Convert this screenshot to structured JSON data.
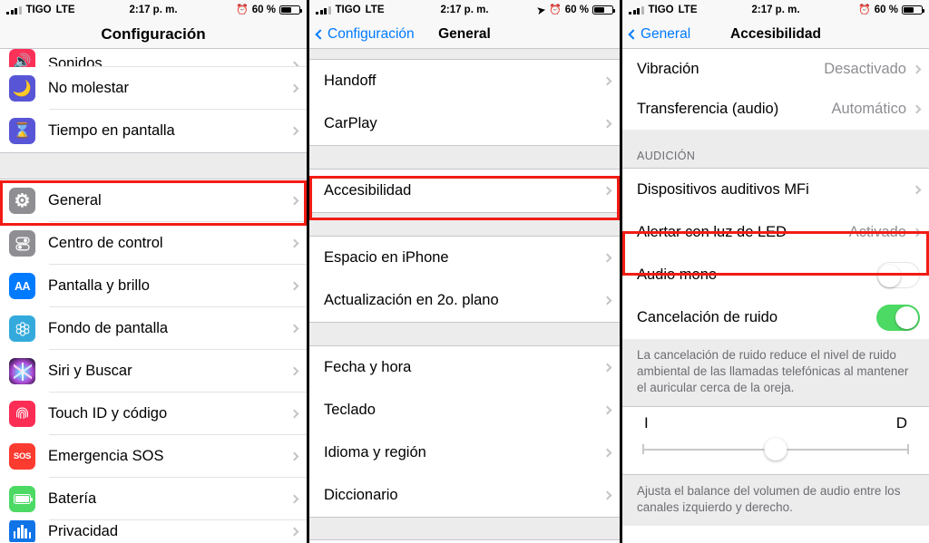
{
  "statusbar": {
    "carrier": "TIGO",
    "network": "LTE",
    "time": "2:17 p. m.",
    "battery_pct": "60 %",
    "alarm_icon": "alarm-clock-icon",
    "location_icon": "location-arrow-icon",
    "signal_icon": "cellular-bars-icon",
    "battery_icon": "battery-icon"
  },
  "panel1": {
    "nav": {
      "title": "Configuración"
    },
    "rows_top": [
      {
        "label": "Sonidos",
        "icon": "sound-icon",
        "icon_color": "#fc3158",
        "partial": true
      },
      {
        "label": "No molestar",
        "icon": "moon-icon",
        "icon_color": "#5856d6"
      },
      {
        "label": "Tiempo en pantalla",
        "icon": "hourglass-icon",
        "icon_color": "#5856d6"
      }
    ],
    "rows_main": [
      {
        "label": "General",
        "icon": "gear-icon",
        "icon_color": "#8e8e93",
        "highlighted": true
      },
      {
        "label": "Centro de control",
        "icon": "control-center-icon",
        "icon_color": "#8e8e93"
      },
      {
        "label": "Pantalla y brillo",
        "icon": "display-brightness-icon",
        "icon_color": "#007aff"
      },
      {
        "label": "Fondo de pantalla",
        "icon": "wallpaper-icon",
        "icon_color": "#34aadc"
      },
      {
        "label": "Siri y Buscar",
        "icon": "siri-icon",
        "icon_color": "#2c1640"
      },
      {
        "label": "Touch ID y código",
        "icon": "fingerprint-icon",
        "icon_color": "#fc2d55"
      },
      {
        "label": "Emergencia SOS",
        "icon": "sos-icon",
        "icon_color": "#fb3b30"
      },
      {
        "label": "Batería",
        "icon": "battery-icon",
        "icon_color": "#4cd964"
      },
      {
        "label": "Privacidad",
        "icon": "privacy-hand-icon",
        "icon_color": "#1074e7",
        "partial": true
      }
    ]
  },
  "panel2": {
    "nav": {
      "back": "Configuración",
      "title": "General"
    },
    "group1": [
      {
        "label": "Handoff"
      },
      {
        "label": "CarPlay"
      }
    ],
    "group2": [
      {
        "label": "Accesibilidad",
        "highlighted": true
      }
    ],
    "group3": [
      {
        "label": "Espacio en iPhone"
      },
      {
        "label": "Actualización en 2o. plano"
      }
    ],
    "group4": [
      {
        "label": "Fecha y hora"
      },
      {
        "label": "Teclado"
      },
      {
        "label": "Idioma y región"
      },
      {
        "label": "Diccionario"
      }
    ]
  },
  "panel3": {
    "nav": {
      "back": "General",
      "title": "Accesibilidad"
    },
    "group_top": [
      {
        "label": "Vibración",
        "value": "Desactivado"
      },
      {
        "label": "Transferencia (audio)",
        "value": "Automático"
      }
    ],
    "section_title": "AUDICIÓN",
    "group_hearing": [
      {
        "label": "Dispositivos auditivos MFi",
        "type": "link"
      },
      {
        "label": "Alertar con luz de LED",
        "value": "Activado",
        "type": "link",
        "highlighted": true
      },
      {
        "label": "Audio mono",
        "type": "toggle",
        "on": false
      },
      {
        "label": "Cancelación de ruido",
        "type": "toggle",
        "on": true
      }
    ],
    "footnote1": "La cancelación de ruido reduce el nivel de ruido ambiental de las llamadas telefónicas al mantener el auricular cerca de la oreja.",
    "balance": {
      "left_label": "I",
      "right_label": "D",
      "value_pct": 50
    },
    "footnote2": "Ajusta el balance del volumen de audio entre los canales izquierdo y derecho."
  },
  "colors": {
    "highlight": "#f21c14",
    "accent": "#007aff",
    "toggle_on": "#4cd964",
    "gray_text": "#8e8e93"
  }
}
